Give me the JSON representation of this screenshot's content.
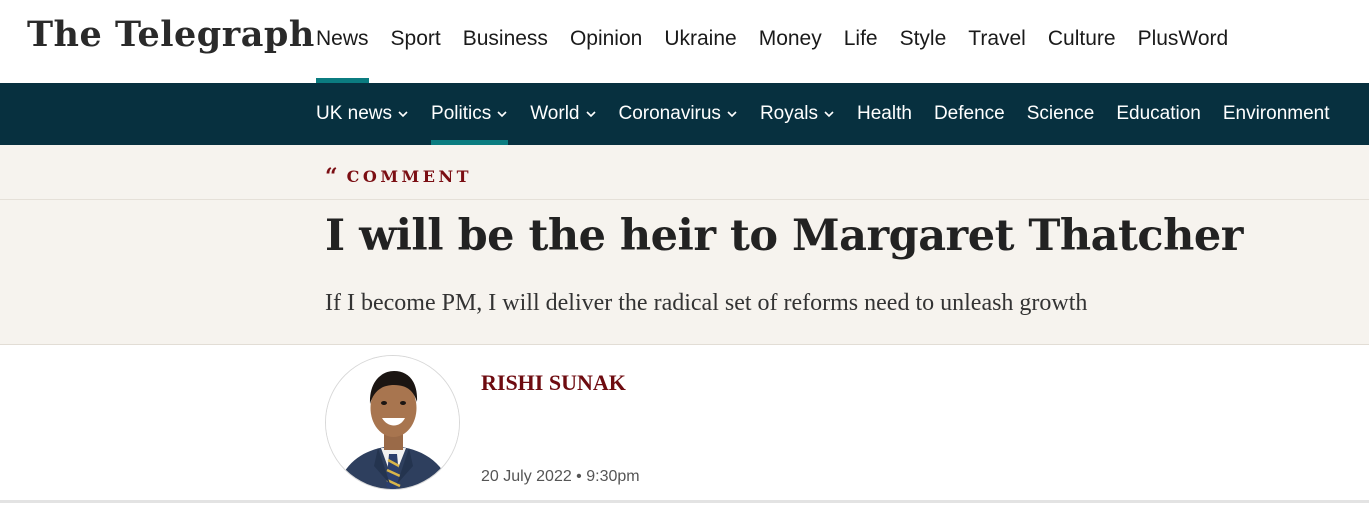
{
  "masthead": {
    "logo_text": "The Telegraph",
    "primary_nav": [
      "News",
      "Sport",
      "Business",
      "Opinion",
      "Ukraine",
      "Money",
      "Life",
      "Style",
      "Travel",
      "Culture",
      "PlusWord"
    ],
    "active_primary": "News"
  },
  "secondary_nav": {
    "items": [
      {
        "label": "UK news",
        "has_dropdown": true
      },
      {
        "label": "Politics",
        "has_dropdown": true,
        "active": true
      },
      {
        "label": "World",
        "has_dropdown": true
      },
      {
        "label": "Coronavirus",
        "has_dropdown": true
      },
      {
        "label": "Royals",
        "has_dropdown": true
      },
      {
        "label": "Health",
        "has_dropdown": false
      },
      {
        "label": "Defence",
        "has_dropdown": false
      },
      {
        "label": "Science",
        "has_dropdown": false
      },
      {
        "label": "Education",
        "has_dropdown": false
      },
      {
        "label": "Environment",
        "has_dropdown": false
      }
    ]
  },
  "article": {
    "kicker": "COMMENT",
    "kicker_icon": "quote-icon",
    "headline": "I will be the heir to Margaret Thatcher",
    "standfirst": "If I become PM, I will deliver the radical set of reforms need to unleash growth",
    "author": "RISHI SUNAK",
    "date": "20 July 2022 • 9:30pm"
  },
  "colors": {
    "nav_bg": "#07303f",
    "accent_teal": "#0b7c80",
    "comment_red": "#7b0e13",
    "band_bg": "#f6f3ee"
  }
}
